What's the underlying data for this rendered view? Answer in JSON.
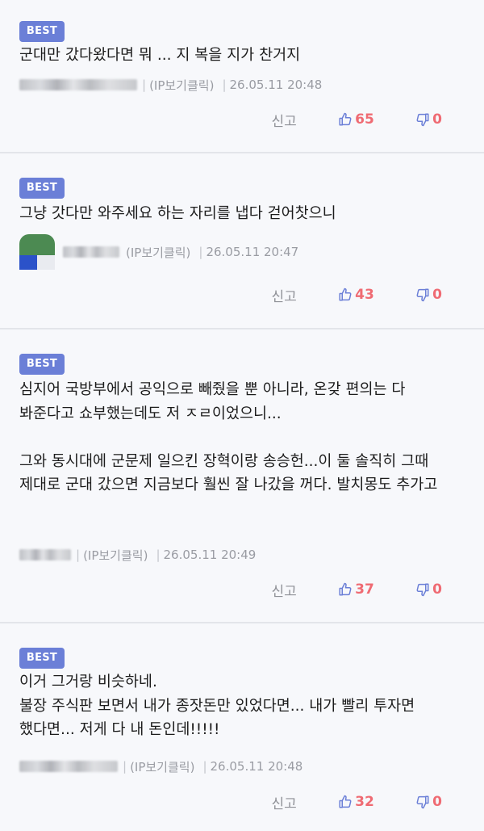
{
  "comments": [
    {
      "badge": "BEST",
      "text": "군대만 갔다왔다면 뭐 ... 지 복을 지가 찬거지",
      "ip": "(IP보기클릭)",
      "date": "26.05.11 20:48",
      "report": "신고",
      "likes": "65",
      "dislikes": "0"
    },
    {
      "badge": "BEST",
      "text": "그냥 갓다만 와주세요 하는 자리를 냅다 걷어찻으니",
      "ip": "(IP보기클릭)",
      "date": "26.05.11 20:47",
      "report": "신고",
      "likes": "43",
      "dislikes": "0"
    },
    {
      "badge": "BEST",
      "text": "심지어 국방부에서 공익으로 빼줬을 뿐 아니라, 온갖 편의는 다 봐준다고 쇼부했는데도 저 ㅈㄹ이었으니...\n\n그와 동시대에 군문제 일으킨 장혁이랑 송승헌...이 둘 솔직히 그때 제대로 군대 갔으면 지금보다 훨씬 잘 나갔을 꺼다. 발치몽도 추가고",
      "ip": "(IP보기클릭)",
      "date": "26.05.11 20:49",
      "report": "신고",
      "likes": "37",
      "dislikes": "0"
    },
    {
      "badge": "BEST",
      "text": "이거 그거랑 비슷하네.\n불장 주식판 보면서 내가 종잣돈만 있었다면... 내가 빨리 투자면 했다면... 저게 다 내 돈인데!!!!!",
      "ip": "(IP보기클릭)",
      "date": "26.05.11 20:48",
      "report": "신고",
      "likes": "32",
      "dislikes": "0"
    }
  ],
  "colors": {
    "badge": "#6b7fd7",
    "like_icon": "#6b7fd7",
    "count": "#ef6b73",
    "meta": "#9a9ca3",
    "background": "#f7f8fb"
  },
  "icons": {
    "like": "thumbs-up-icon",
    "dislike": "thumbs-down-icon"
  }
}
